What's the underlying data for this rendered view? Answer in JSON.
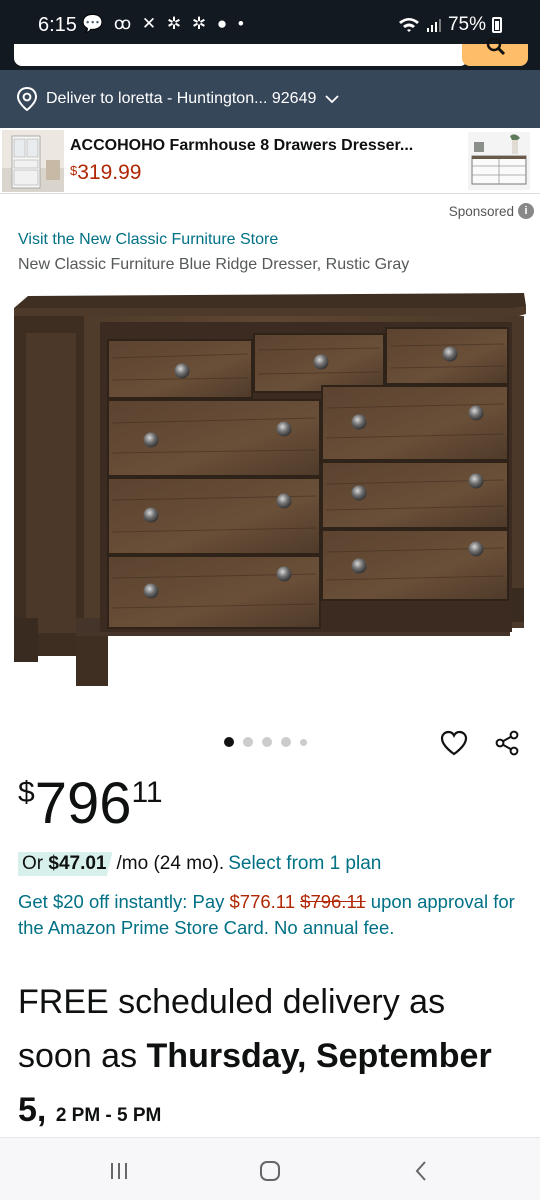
{
  "status_bar": {
    "time": "6:15",
    "left_icons": "💬 ꝏ ✕ ✲ ✲ ● •",
    "battery": "75%"
  },
  "deliver": {
    "text": "Deliver to loretta - Huntington... 92649"
  },
  "ad": {
    "title": "ACCOHOHO Farmhouse 8 Drawers Dresser...",
    "currency": "$",
    "price": "319.99"
  },
  "sponsored_label": "Sponsored",
  "store_link": "Visit the New Classic Furniture Store",
  "product_title": "New Classic Furniture Blue Ridge Dresser, Rustic Gray",
  "carousel": {
    "total": 5,
    "active": 0
  },
  "price": {
    "symbol": "$",
    "whole": "796",
    "fraction": "11"
  },
  "monthly": {
    "prefix": "Or ",
    "amount": "$47.01",
    "term": "/mo (24 mo).",
    "link": "Select from 1 plan"
  },
  "card_offer": {
    "text1": "Get $20 off instantly: Pay ",
    "new_price": "$776.11",
    "old_price": "$796.11",
    "text2": " upon approval for the Amazon Prime Store Card. No annual fee."
  },
  "delivery": {
    "line1": "FREE scheduled delivery as soon as ",
    "day": "Thursday,",
    "date": "September 5,",
    "window": "2 PM - 5 PM"
  },
  "colors": {
    "header_dark": "#131921",
    "deliver_bar": "#37475a",
    "link": "#007185",
    "price_red": "#b12704",
    "search_button": "#febd69"
  }
}
